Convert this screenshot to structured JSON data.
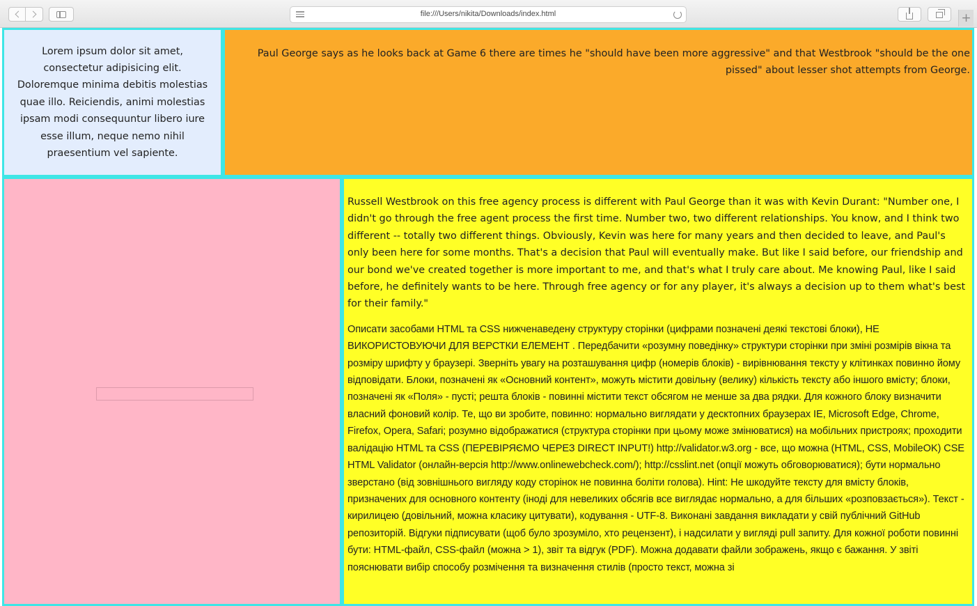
{
  "browser": {
    "url": "file:///Users/nikita/Downloads/index.html",
    "new_tab_label": "+",
    "icons": [
      "chevron-left-icon",
      "chevron-right-icon",
      "sidebar-icon",
      "reader-icon",
      "reload-icon",
      "share-icon",
      "tabs-icon",
      "plus-icon"
    ]
  },
  "page": {
    "block1_text": "Lorem ipsum dolor sit amet, consectetur adipisicing elit. Doloremque minima debitis molestias quae illo. Reiciendis, animi molestias ipsam modi consequuntur libero iure esse illum, neque nemo nihil praesentium vel sapiente.",
    "block2_text": "Paul George says as he looks back at Game 6 there are times he \"should have been more aggressive\" and that Westbrook \"should be the one pissed\" about lesser shot attempts from George.",
    "block4_paragraph1": "Russell Westbrook on this free agency process is different with Paul George than it was with Kevin Durant: \"Number one, I didn't go through the free agent process the first time. Number two, two different relationships. You know, and I think two different -- totally two different things. Obviously, Kevin was here for many years and then decided to leave, and Paul's only been here for some months. That's a decision that Paul will eventually make. But like I said before, our friendship and our bond we've created together is more important to me, and that's what I truly care about. Me knowing Paul, like I said before, he definitely wants to be here. Through free agency or for any player, it's always a decision up to them what's best for their family.\"",
    "block4_paragraph2": "Описати засобами HTML та CSS нижченаведену структуру сторінки (цифрами позначені деякі текстові блоки), НЕ ВИКОРИСТОВУЮЧИ ДЛЯ ВЕРСТКИ ЕЛЕМЕНТ . Передбачити «розумну поведінку» структури сторінки при зміні розмірів вікна та розміру шрифту у браузері. Зверніть увагу на розташування цифр (номерів блоків) - вирівнювання тексту у клітинках повинно йому відповідати. Блоки, позначені як «Основний контент», можуть містити довільну (велику) кількість тексту або іншого вмісту; блоки, позначені як «Поля» - пусті; решта блоків - повинні містити текст обсягом не менше за два рядки. Для кожного блоку визначити власний фоновий колір. Те, що ви зробите, повинно: нормально виглядати у десктопних браузерах IE, Microsoft Edge, Chrome, Firefox, Opera, Safari; розумно відображатися (структура сторінки при цьому може змінюватися) на мобільних пристроях; проходити валідацію HTML та CSS (ПЕРЕВІРЯЄМО ЧЕРЕЗ DIRECT INPUT!) http://validator.w3.org - все, що можна (HTML, CSS, MobileOK) CSE HTML Validator (онлайн-версія http://www.onlinewebcheck.com/); http://csslint.net (опції можуть обговорюватися); бути нормально зверстано (від зовнішнього вигляду коду сторінок не повинна боліти голова). Hint: Не шкодуйте тексту для вмісту блоків, призначених для основного контенту (іноді для невеликих обсягів все виглядає нормально, а для більших «розповзається»). Текст - кирилицею (довільний, можна класику цитувати), кодування - UTF-8. Виконані завдання викладати у свій публічний GitHub репозиторій. Відгуки підписувати (щоб було зрозуміло, хто рецензент), і надсилати у вигляді pull запиту. Для кожної роботи повинні бути: HTML-файл, CSS-файл (можна > 1), звіт та відгук (PDF). Можна додавати файли зображень, якщо є бажання. У звіті пояснювати вибір способу розмічення та визначення стилів (просто текст, можна зі"
  },
  "colors": {
    "block1_bg": "#e3edfd",
    "block2_bg": "#fbaa2a",
    "block3_bg": "#ffb6c7",
    "block4_bg": "#ffff26",
    "block_border": "#3ee6e6"
  }
}
